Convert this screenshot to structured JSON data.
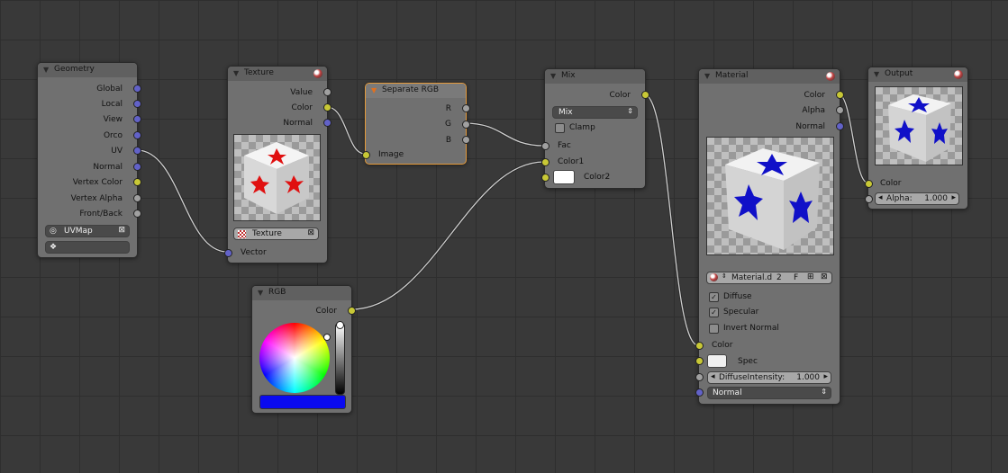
{
  "nodes": {
    "geometry": {
      "title": "Geometry",
      "outputs": [
        "Global",
        "Local",
        "View",
        "Orco",
        "UV",
        "Normal",
        "Vertex Color",
        "Vertex Alpha",
        "Front/Back"
      ],
      "uv_map": "UVMap",
      "vertex_color": ""
    },
    "texture": {
      "title": "Texture",
      "outputs": [
        "Value",
        "Color",
        "Normal"
      ],
      "texture_name": "Texture",
      "input": "Vector"
    },
    "separate_rgb": {
      "title": "Separate RGB",
      "outputs": [
        "R",
        "G",
        "B"
      ],
      "input": "Image"
    },
    "mix": {
      "title": "Mix",
      "output": "Color",
      "blend_mode": "Mix",
      "clamp_label": "Clamp",
      "clamp_checked": false,
      "inputs": [
        "Fac",
        "Color1",
        "Color2"
      ]
    },
    "rgb": {
      "title": "RGB",
      "output": "Color",
      "swatch_color": "#0a0af0"
    },
    "material": {
      "title": "Material",
      "outputs": [
        "Color",
        "Alpha",
        "Normal"
      ],
      "material_name": "Material.d",
      "user_count": "2",
      "fake_user": "F",
      "diffuse_label": "Diffuse",
      "diffuse_checked": true,
      "specular_label": "Specular",
      "specular_checked": true,
      "invert_normal_label": "Invert Normal",
      "invert_normal_checked": false,
      "inputs": {
        "color": "Color",
        "spec": "Spec",
        "diffuse_intensity_label": "DiffuseIntensity:",
        "diffuse_intensity_value": "1.000",
        "normal": "Normal"
      }
    },
    "output": {
      "title": "Output",
      "input_color": "Color",
      "alpha_label": "Alpha:",
      "alpha_value": "1.000"
    }
  },
  "colors": {
    "vector_socket": "#6262c8",
    "color_socket": "#c8c836",
    "value_socket": "#a0a0a0",
    "active_node_border": "#e59a3a"
  },
  "icons": {
    "collapse": "triangle-down-icon",
    "material_preview": "material-ball-icon",
    "texture_browse": "checker-texture-icon",
    "remove": "close-icon",
    "add": "plus-icon"
  }
}
